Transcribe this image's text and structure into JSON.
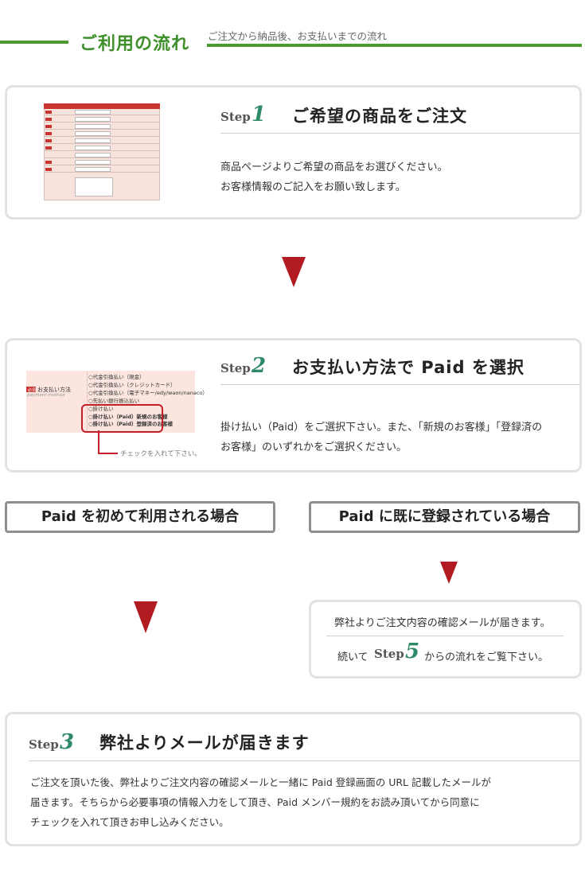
{
  "header": {
    "title": "ご利用の流れ",
    "subtitle": "ご注文から納品後、お支払いまでの流れ"
  },
  "step1": {
    "label": "Step",
    "num": "1",
    "title": "ご希望の商品をご注文",
    "body_line1": "商品ページよりご希望の商品をお選びください。",
    "body_line2": "お客様情報のご記入をお願い致します。"
  },
  "step2": {
    "label": "Step",
    "num": "2",
    "title": "お支払い方法で Paid を選択",
    "body_line1": "掛け払い（Paid）をご選択下さい。また、「新規のお客様」「登録済の",
    "body_line2": "お客様」のいずれかをご選択ください。",
    "thumb": {
      "field_label": "お支払い方法",
      "field_label_en": "payment method",
      "required_badge": "必須",
      "options": [
        "代金引換払い（現金）",
        "代金引換払い（クレジットカード）",
        "代金引換払い（電子マネー/edy/waon/nanaco）",
        "先払い銀行振込払い",
        "掛け払い",
        "掛け払い（Paid）新規のお客様",
        "掛け払い（Paid）登録済のお客様"
      ],
      "note": "チェックを入れて下さい。"
    }
  },
  "options": {
    "first_time": "Paid を初めて利用される場合",
    "registered": "Paid に既に登録されている場合"
  },
  "registered_box": {
    "line1": "弊社よりご注文内容の確認メールが届きます。",
    "line2_pre": "続いて",
    "step_label": "Step",
    "step_num": "5",
    "line2_post": "からの流れをご覧下さい。"
  },
  "step3": {
    "label": "Step",
    "num": "3",
    "title": "弊社よりメールが届きます",
    "body_line1": "ご注文を頂いた後、弊社よりご注文内容の確認メールと一緒に Paid 登録画面の URL 記載したメールが",
    "body_line2": "届きます。そちらから必要事項の情報入力をして頂き、Paid メンバー規約をお読み頂いてから同意に",
    "body_line3": "チェックを入れて頂きお申し込みください。"
  },
  "colors": {
    "green": "#4a9a2e",
    "step_num": "#2f8a68",
    "arrow_red": "#b31b22",
    "card_border": "#e2e2e2"
  }
}
